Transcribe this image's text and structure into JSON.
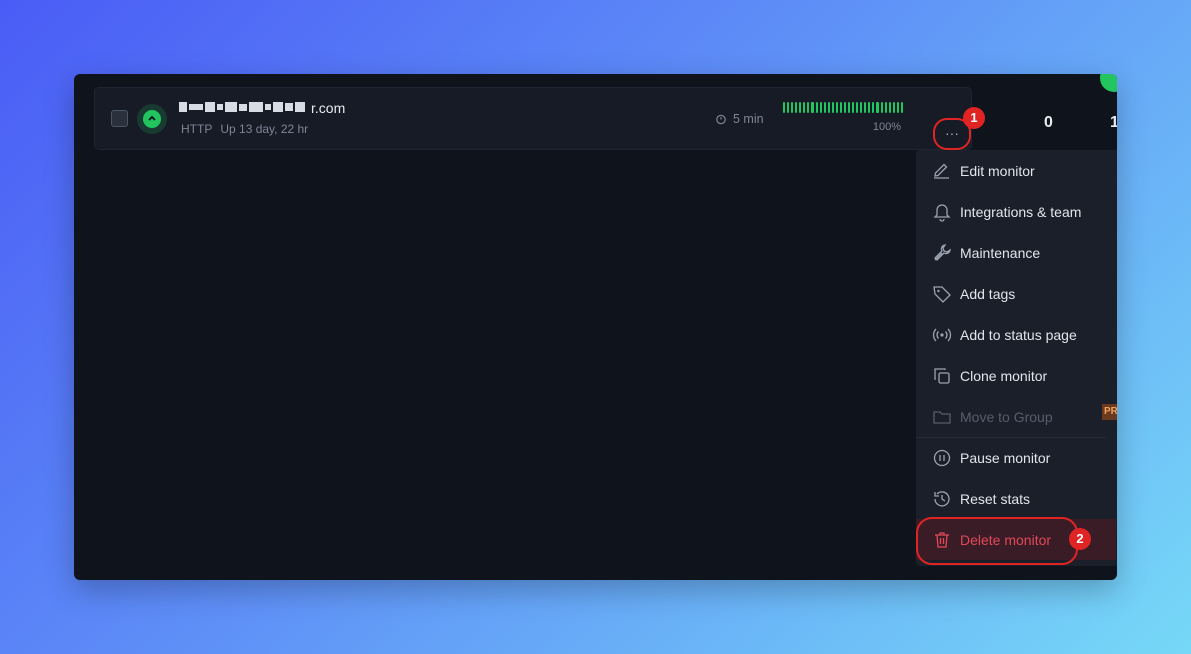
{
  "monitor": {
    "name_suffix": "r.com",
    "type": "HTTP",
    "uptime_text": "Up 13 day, 22 hr",
    "interval": "5 min",
    "uptime_percent": "100%",
    "more_label": "···"
  },
  "callouts": {
    "step1": "1",
    "step2": "2"
  },
  "stats": {
    "count_a": "0",
    "count_b": "1"
  },
  "menu": {
    "items": [
      {
        "label": "Edit monitor",
        "icon": "pencil-icon"
      },
      {
        "label": "Integrations & team",
        "icon": "bell-icon"
      },
      {
        "label": "Maintenance",
        "icon": "wrench-icon"
      },
      {
        "label": "Add tags",
        "icon": "tag-icon"
      },
      {
        "label": "Add to status page",
        "icon": "broadcast-icon"
      },
      {
        "label": "Clone monitor",
        "icon": "copy-icon"
      },
      {
        "label": "Move to Group",
        "icon": "folder-icon",
        "disabled": true,
        "tag": "PR"
      },
      {
        "label": "Pause monitor",
        "icon": "pause-circle-icon"
      },
      {
        "label": "Reset stats",
        "icon": "history-icon"
      },
      {
        "label": "Delete monitor",
        "icon": "trash-icon",
        "danger": true
      }
    ]
  },
  "colors": {
    "accent_green": "#22c55e",
    "danger_red": "#e2485a",
    "callout_red": "#e02424",
    "panel_bg": "#0e131c"
  }
}
